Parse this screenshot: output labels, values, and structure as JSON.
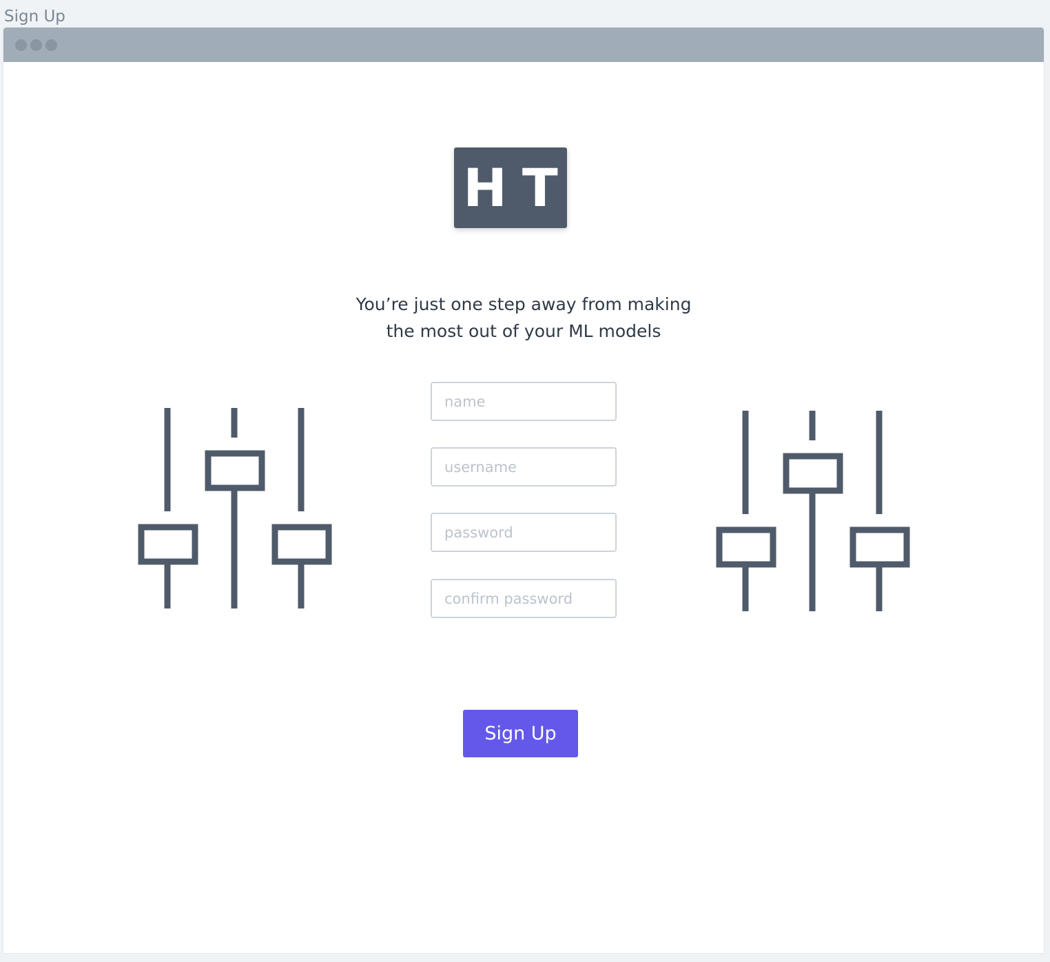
{
  "page": {
    "label": "Sign Up"
  },
  "logo": {
    "text": "HT"
  },
  "tagline": {
    "line1": "You’re just one step away from making",
    "line2": "the most out of your ML models"
  },
  "form": {
    "fields": [
      {
        "placeholder": "name",
        "value": ""
      },
      {
        "placeholder": "username",
        "value": ""
      },
      {
        "placeholder": "password",
        "value": ""
      },
      {
        "placeholder": "confirm password",
        "value": ""
      }
    ],
    "submit_label": "Sign Up"
  },
  "icons": {
    "left": "equalizer-sliders-icon",
    "right": "equalizer-sliders-icon"
  },
  "colors": {
    "brand_dark": "#4f5b6a",
    "accent": "#6458ea",
    "titlebar": "#a0acb8"
  }
}
